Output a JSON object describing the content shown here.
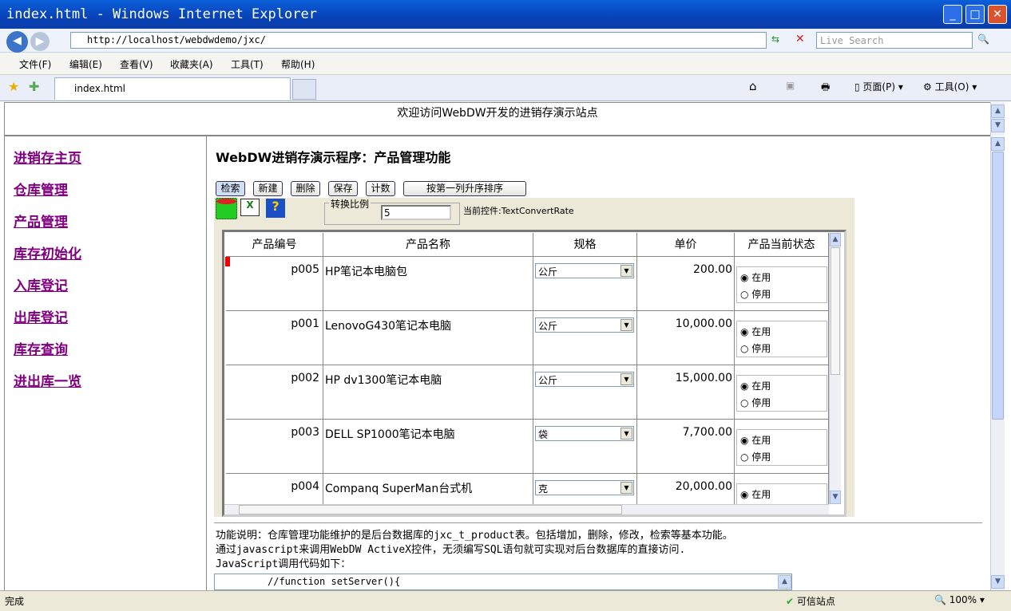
{
  "window": {
    "title": "index.html - Windows Internet Explorer"
  },
  "address": {
    "url": "http://localhost/webdwdemo/jxc/",
    "search_placeholder": "Live Search"
  },
  "menu": [
    "文件(F)",
    "编辑(E)",
    "查看(V)",
    "收藏夹(A)",
    "工具(T)",
    "帮助(H)"
  ],
  "tab": {
    "label": "index.html"
  },
  "toolbar_right": {
    "page": "页面(P)",
    "tools": "工具(O)"
  },
  "welcome": "欢迎访问WebDW开发的进销存演示站点",
  "nav": [
    "进销存主页",
    "仓库管理",
    "产品管理",
    "库存初始化",
    "入库登记",
    "出库登记",
    "库存查询",
    "进出库一览"
  ],
  "main": {
    "title": "WebDW进销存演示程序：产品管理功能",
    "buttons": [
      "检索",
      "新建",
      "删除",
      "保存",
      "计数",
      "按第一列升序排序"
    ],
    "ratio_label": "转换比例",
    "ratio_value": "5",
    "current_control": "当前控件:TextConvertRate",
    "columns": [
      "产品编号",
      "产品名称",
      "规格",
      "单价",
      "产品当前状态"
    ],
    "rows": [
      {
        "id": "p005",
        "name": "HP笔记本电脑包",
        "unit": "公斤",
        "price": "200.00",
        "status": "在用"
      },
      {
        "id": "p001",
        "name": "LenovoG430笔记本电脑",
        "unit": "公斤",
        "price": "10,000.00",
        "status": "在用"
      },
      {
        "id": "p002",
        "name": "HP dv1300笔记本电脑",
        "unit": "公斤",
        "price": "15,000.00",
        "status": "在用"
      },
      {
        "id": "p003",
        "name": "DELL SP1000笔记本电脑",
        "unit": "袋",
        "price": "7,700.00",
        "status": "在用"
      },
      {
        "id": "p004",
        "name": "Companq SuperMan台式机",
        "unit": "克",
        "price": "20,000.00",
        "status": "在用"
      }
    ],
    "radio_options": [
      "在用",
      "停用"
    ],
    "desc": [
      "功能说明：仓库管理功能维护的是后台数据库的jxc_t_product表。包括增加，删除，修改，检索等基本功能。",
      "通过javascript来调用WebDW ActiveX控件，无须编写SQL语句就可实现对后台数据库的直接访问.",
      "JavaScript调用代码如下："
    ],
    "code": "//function setServer(){"
  },
  "status": {
    "left": "完成",
    "zone": "可信站点",
    "zoom": "100%"
  }
}
